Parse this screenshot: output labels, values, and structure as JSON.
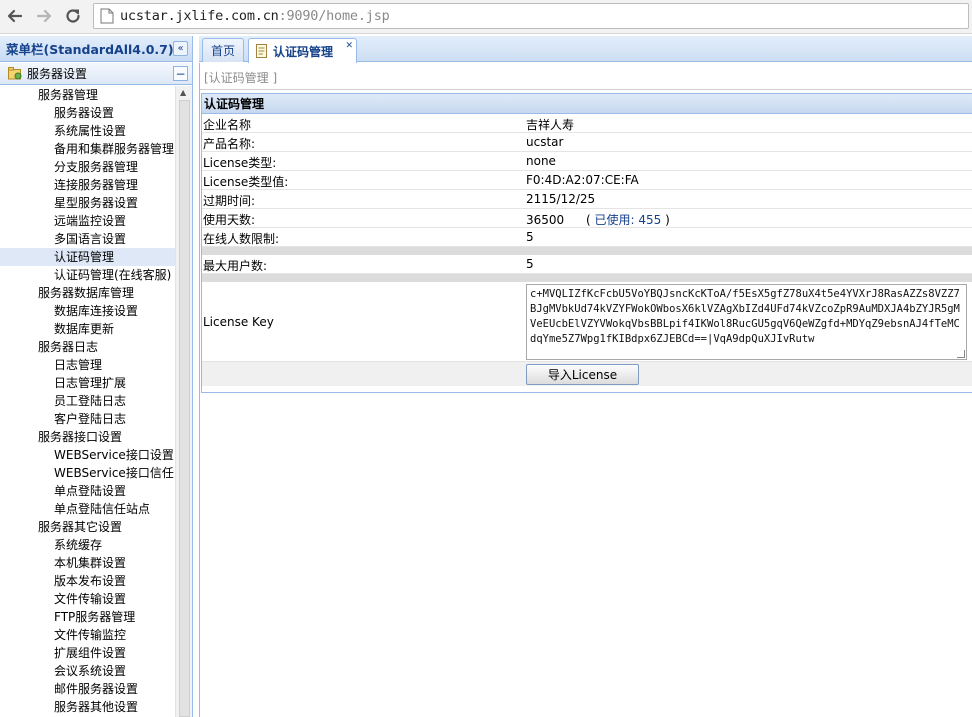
{
  "browser": {
    "url_host": "ucstar.jxlife.com.cn",
    "url_rest": ":9090/home.jsp"
  },
  "sidebar": {
    "title": "菜单栏(StandardAll4.0.7)",
    "section_label": "服务器设置",
    "items": [
      {
        "label": "服务器管理",
        "level": 1
      },
      {
        "label": "服务器设置",
        "level": 2
      },
      {
        "label": "系统属性设置",
        "level": 2
      },
      {
        "label": "备用和集群服务器管理",
        "level": 2
      },
      {
        "label": "分支服务器管理",
        "level": 2
      },
      {
        "label": "连接服务器管理",
        "level": 2
      },
      {
        "label": "星型服务器设置",
        "level": 2
      },
      {
        "label": "远端监控设置",
        "level": 2
      },
      {
        "label": "多国语言设置",
        "level": 2
      },
      {
        "label": "认证码管理",
        "level": 2,
        "selected": true
      },
      {
        "label": "认证码管理(在线客服)",
        "level": 2
      },
      {
        "label": "服务器数据库管理",
        "level": 1
      },
      {
        "label": "数据库连接设置",
        "level": 2
      },
      {
        "label": "数据库更新",
        "level": 2
      },
      {
        "label": "服务器日志",
        "level": 1
      },
      {
        "label": "日志管理",
        "level": 2
      },
      {
        "label": "日志管理扩展",
        "level": 2
      },
      {
        "label": "员工登陆日志",
        "level": 2
      },
      {
        "label": "客户登陆日志",
        "level": 2
      },
      {
        "label": "服务器接口设置",
        "level": 1
      },
      {
        "label": "WEBService接口设置",
        "level": 2
      },
      {
        "label": "WEBService接口信任",
        "level": 2
      },
      {
        "label": "单点登陆设置",
        "level": 2
      },
      {
        "label": "单点登陆信任站点",
        "level": 2
      },
      {
        "label": "服务器其它设置",
        "level": 1
      },
      {
        "label": "系统缓存",
        "level": 2
      },
      {
        "label": "本机集群设置",
        "level": 2
      },
      {
        "label": "版本发布设置",
        "level": 2
      },
      {
        "label": "文件传输设置",
        "level": 2
      },
      {
        "label": "FTP服务器管理",
        "level": 2
      },
      {
        "label": "文件传输监控",
        "level": 2
      },
      {
        "label": "扩展组件设置",
        "level": 2
      },
      {
        "label": "会议系统设置",
        "level": 2
      },
      {
        "label": "邮件服务器设置",
        "level": 2
      },
      {
        "label": "服务器其他设置",
        "level": 2
      }
    ]
  },
  "tabs": {
    "home": "首页",
    "active": "认证码管理"
  },
  "main": {
    "breadcrumb": "[认证码管理 ]",
    "panel_title": "认证码管理",
    "rows": [
      {
        "key": "企业名称",
        "value": "吉祥人寿"
      },
      {
        "key": "产品名称:",
        "value": "ucstar"
      },
      {
        "key": "License类型:",
        "value": "none"
      },
      {
        "key": "License类型值:",
        "value": "F0:4D:A2:07:CE:FA"
      },
      {
        "key": "过期时间:",
        "value": "2115/12/25"
      },
      {
        "key": "使用天数:",
        "value": "36500"
      },
      {
        "key": "在线人数限制:",
        "value": "5"
      }
    ],
    "used_open": "(",
    "used_label": "已使用:",
    "used_value": "455",
    "used_close": ")",
    "max_users_label": "最大用户数:",
    "max_users_value": "5",
    "license_key_label": "License Key",
    "license_key_value": "c+MVQLIZfKcFcbU5VoYBQJsncKcKToA/f5EsX5gfZ78uX4t5e4YVXrJ8RasAZZs8VZZ7BJgMVbkUd74kVZYFWokOWbosX6klVZAgXbIZd4UFd74kVZcoZpR9AuMDXJA4bZYJR5gMVeEUcbElVZYVWokqVbsBBLpif4IKWol8RucGU5gqV6QeWZgfd+MDYqZ9ebsnAJ4fTeMCdqYme5Z7Wpg1fKIBdpx6ZJEBCd==|VqA9dpQuXJIvRutw",
    "import_button": "导入License"
  }
}
